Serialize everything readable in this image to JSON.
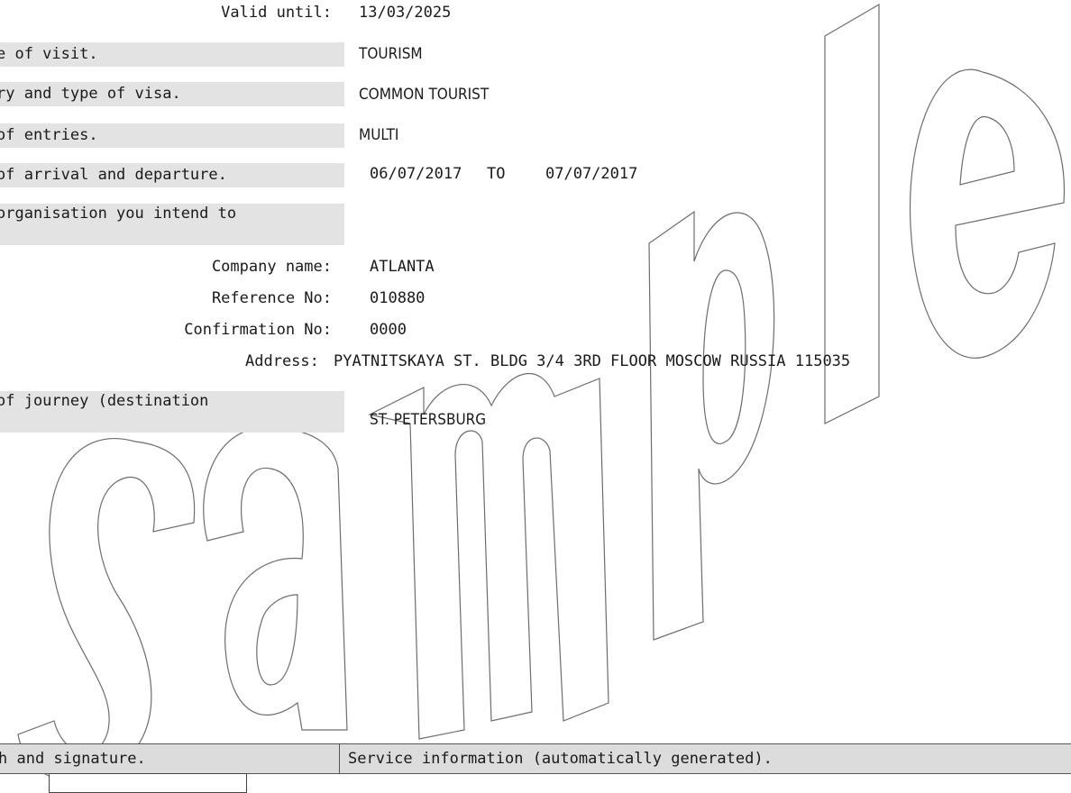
{
  "form": {
    "valid_until": {
      "label": "Valid until:",
      "value": "13/03/2025"
    },
    "purpose": {
      "label": "e of visit.",
      "value": "TOURISM"
    },
    "category": {
      "label": "ry and type of visa.",
      "value": "COMMON TOURIST"
    },
    "entries": {
      "label": " of entries.",
      "value": "MULTI"
    },
    "dates": {
      "label": "of arrival and departure.",
      "from": "06/07/2017",
      "to_word": "TO",
      "to": "07/07/2017"
    },
    "organisation": {
      "label": "organisation you intend to"
    },
    "company_name": {
      "label": "Company name:",
      "value": "ATLANTA"
    },
    "reference_no": {
      "label": "Reference No:",
      "value": "010880"
    },
    "confirmation_no": {
      "label": "Confirmation No:",
      "value": "0000"
    },
    "address": {
      "label": "Address:",
      "value": "PYATNITSKAYA ST. BLDG 3/4 3RD FLOOR MOSCOW RUSSIA 115035"
    },
    "route": {
      "label": " of journey (destination",
      "value": "ST. PETERSBURG"
    }
  },
  "footer": {
    "photo_label": "h and signature.",
    "service_label": "Service information (automatically generated)."
  },
  "watermark": {
    "text": "Sample"
  }
}
